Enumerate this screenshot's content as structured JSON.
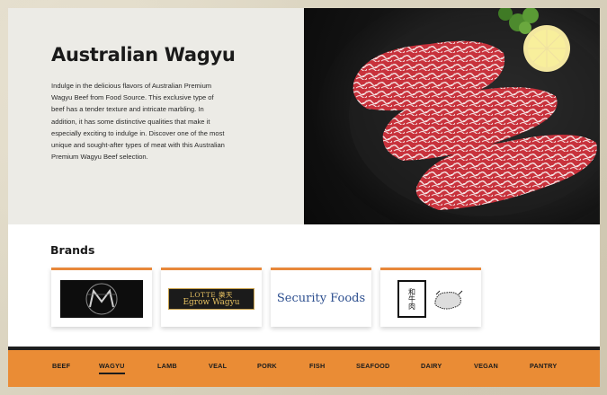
{
  "hero": {
    "title": "Australian Wagyu",
    "description": "Indulge in the delicious flavors of Australian Premium Wagyu Beef from Food Source. This exclusive type of beef has a tender texture and intricate marbling. In addition, it has some distinctive qualities that make it especially exciting to indulge in. Discover one of the most unique and sought-after types of meat with this Australian Premium Wagyu Beef selection."
  },
  "brands": {
    "title": "Brands",
    "items": [
      {
        "name": "m-logo"
      },
      {
        "name": "lotte-egrow-wagyu",
        "top": "LOTTE 樂天",
        "bottom": "Egrow Wagyu"
      },
      {
        "name": "security-foods",
        "text": "Security Foods"
      },
      {
        "name": "wagyu-bull-logo",
        "text": "和牛肉"
      }
    ]
  },
  "nav": {
    "items": [
      "BEEF",
      "WAGYU",
      "LAMB",
      "VEAL",
      "PORK",
      "FISH",
      "SEAFOOD",
      "DAIRY",
      "VEGAN",
      "PANTRY"
    ],
    "active": "WAGYU"
  }
}
